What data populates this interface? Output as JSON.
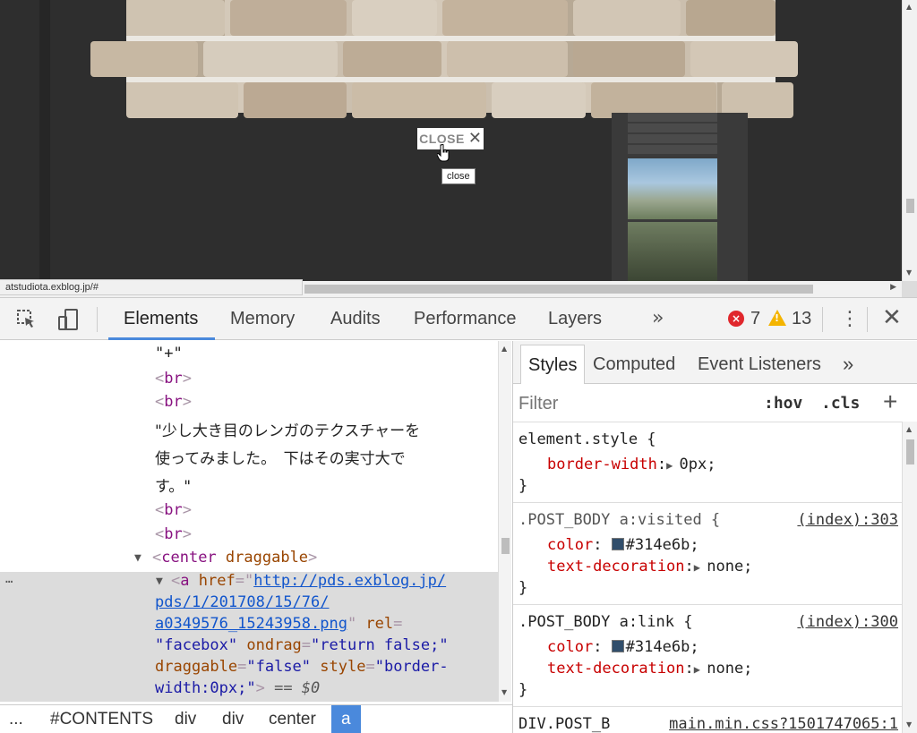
{
  "page": {
    "close_label": "CLOSE",
    "close_symbol": "✕",
    "tooltip": "close",
    "status_url": "atstudiota.exblog.jp/#"
  },
  "devtools": {
    "tabs": [
      "Elements",
      "Memory",
      "Audits",
      "Performance",
      "Layers"
    ],
    "more_tabs": "»",
    "errors": "7",
    "warnings": "13",
    "menu": "⋮",
    "close": "✕",
    "accent": "#4a89dc",
    "error_color": "#e0272c",
    "warning_color": "#f4b400"
  },
  "elements": {
    "lines": {
      "plus_text": "\"+\"",
      "br": "br",
      "jp_text_1": "\"少し大き目のレンガのテクスチャーを",
      "jp_text_2": "使ってみました。　下はその実寸大で",
      "jp_text_3": "す。\"",
      "center_tag": "center",
      "center_attr": "draggable",
      "a_tag": "a",
      "href_name": "href",
      "href_1": "http://pds.exblog.jp/",
      "href_2": "pds/1/201708/15/76/",
      "href_3": "a0349576_15243958.png",
      "rel_name": "rel",
      "rel_val": "\"facebox\"",
      "ondrag_name": "ondrag",
      "ondrag_val": "\"return false;\"",
      "draggable_name": "draggable",
      "draggable_val": "\"false\"",
      "style_name": "style",
      "style_val_1": "\"border-",
      "style_val_2": "width:0px;\"",
      "eq_dollar": "== $0",
      "ellipsis": "…"
    },
    "breadcrumbs": [
      "...",
      "#CONTENTS",
      "div",
      "div",
      "center",
      "a"
    ]
  },
  "styles": {
    "sub_tabs": [
      "Styles",
      "Computed",
      "Event Listeners"
    ],
    "sub_more": "»",
    "filter_placeholder": "Filter",
    "hov": ":hov",
    "cls": ".cls",
    "plus": "+",
    "rules": {
      "r1_selector": "element.style {",
      "r1_prop": "border-width",
      "r1_val": "0px;",
      "r2_selector": ".POST_BODY a:visited {",
      "r2_source": "(index):303",
      "r2_p1": "color",
      "r2_v1": "#314e6b;",
      "r2_p2": "text-decoration",
      "r2_v2": "none;",
      "r3_selector": ".POST_BODY a:link {",
      "r3_source": "(index):300",
      "r3_p1": "color",
      "r3_v1": "#314e6b;",
      "r3_p2": "text-decoration",
      "r3_v2": "none;",
      "r4_selector": "DIV.POST_B",
      "r4_source": "main.min.css?1501747065:1",
      "close_brace": "}",
      "swatch_color": "#314e6b"
    }
  }
}
